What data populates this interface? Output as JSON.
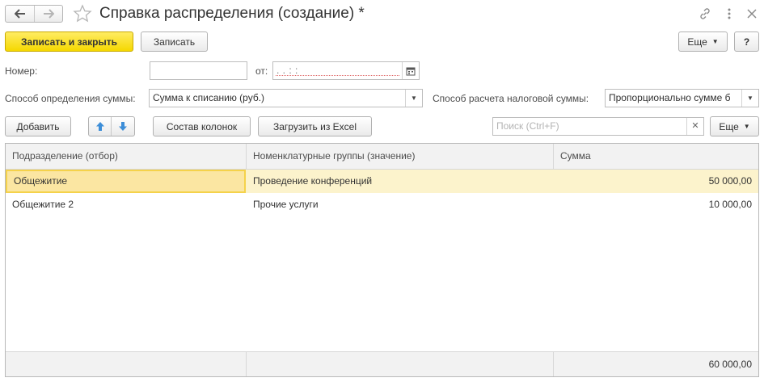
{
  "window": {
    "title": "Справка распределения (создание) *"
  },
  "toolbar": {
    "save_close_label": "Записать и закрыть",
    "save_label": "Записать",
    "more_label": "Еще",
    "help_label": "?"
  },
  "form": {
    "number_label": "Номер:",
    "number_value": "",
    "date_label": "от:",
    "date_mask": ". .   : :",
    "sum_method_label": "Способ определения суммы:",
    "sum_method_value": "Сумма к списанию (руб.)",
    "tax_method_label": "Способ расчета налоговой суммы:",
    "tax_method_value": "Пропорционально сумме б"
  },
  "table_toolbar": {
    "add_label": "Добавить",
    "columns_label": "Состав колонок",
    "excel_label": "Загрузить из Excel",
    "search_placeholder": "Поиск (Ctrl+F)",
    "more_label": "Еще"
  },
  "table": {
    "columns": [
      "Подразделение (отбор)",
      "Номенклатурные группы (значение)",
      "Сумма"
    ],
    "rows": [
      {
        "dept": "Общежитие",
        "group": "Проведение конференций",
        "sum": "50 000,00"
      },
      {
        "dept": "Общежитие 2",
        "group": "Прочие услуги",
        "sum": "10 000,00"
      }
    ],
    "total": "60 000,00"
  },
  "colors": {
    "primary_button": "#f5d800",
    "selected_row": "#fcf3cc",
    "focused_cell_border": "#f5d24a",
    "arrow_icon": "#3d8ed8"
  }
}
